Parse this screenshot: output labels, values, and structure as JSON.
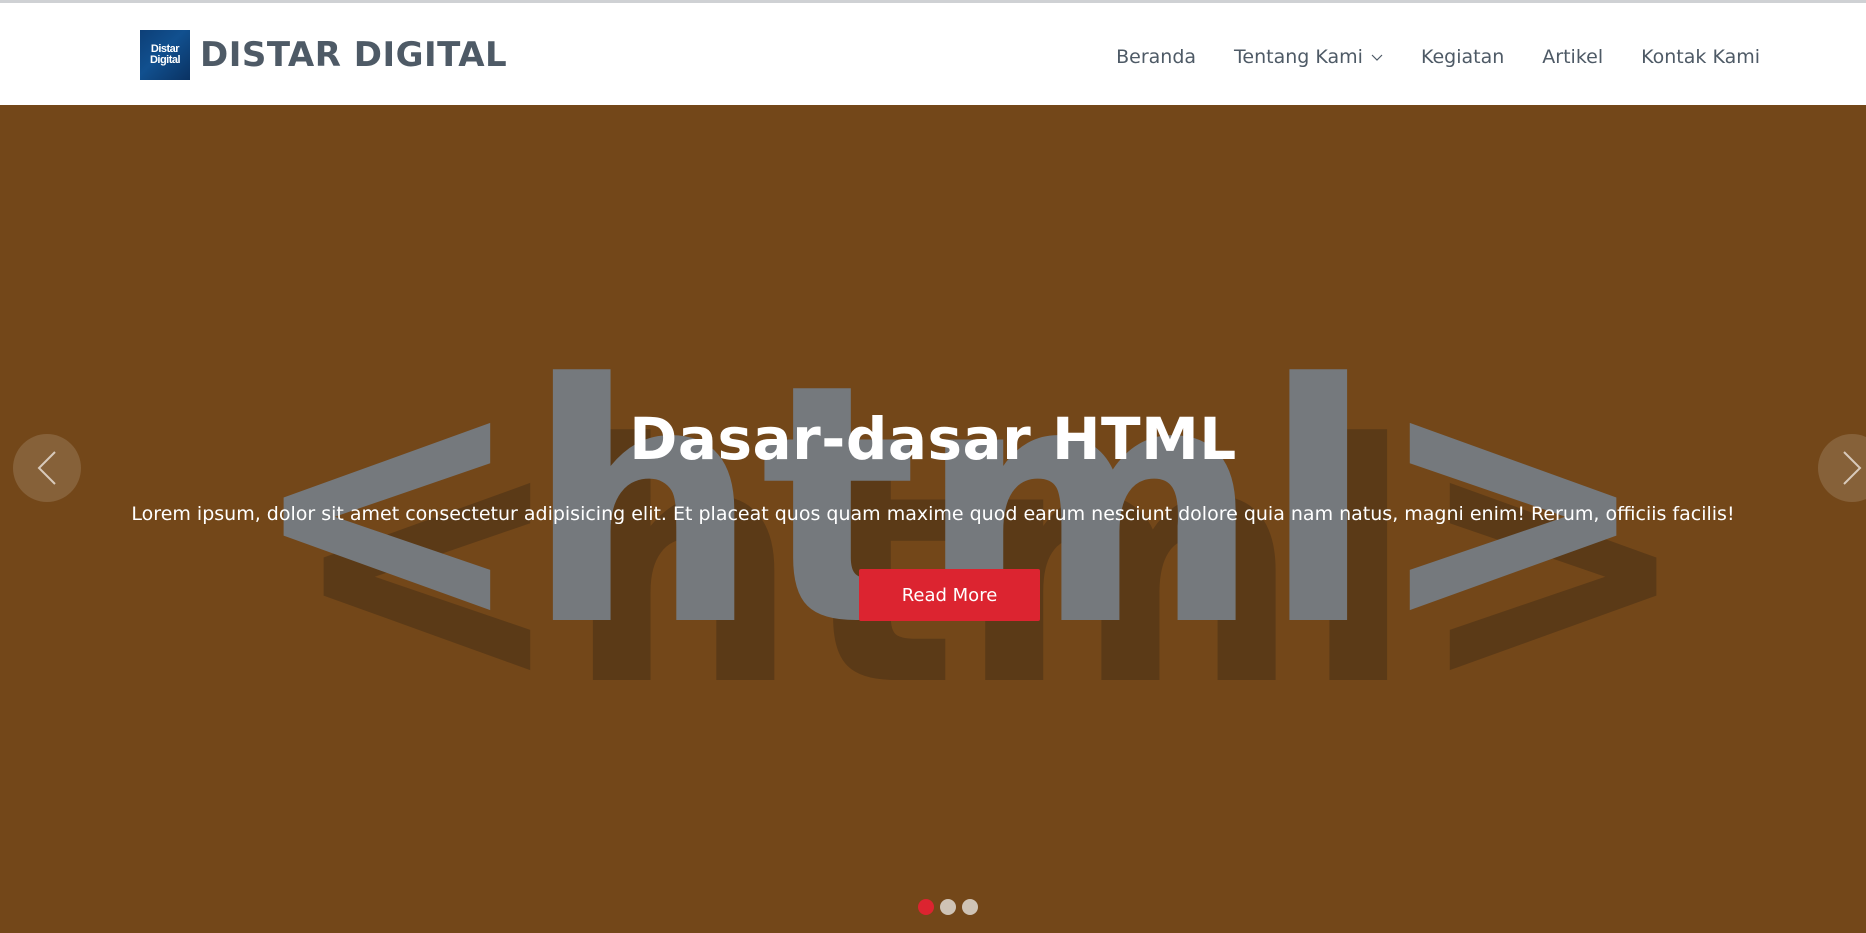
{
  "brand": {
    "logo_line1": "Distar",
    "logo_line2": "Digital",
    "name": "DISTAR DIGITAL"
  },
  "nav": {
    "items": [
      {
        "label": "Beranda"
      },
      {
        "label": "Tentang Kami",
        "has_dropdown": true
      },
      {
        "label": "Kegiatan"
      },
      {
        "label": "Artikel"
      },
      {
        "label": "Kontak Kami"
      }
    ]
  },
  "hero": {
    "background_graphic_text": "<html>",
    "title": "Dasar-dasar HTML",
    "description": "Lorem ipsum, dolor sit amet consectetur adipisicing elit. Et placeat quos quam maxime quod earum nesciunt dolore quia nam natus, magni enim! Rerum, officiis facilis!",
    "button_label": "Read More",
    "prev_icon": "chevron-left-icon",
    "next_icon": "chevron-right-icon",
    "slides_count": 3,
    "active_slide": 1
  },
  "colors": {
    "hero_bg": "#734719",
    "accent": "#dc2430",
    "nav_text": "#4e5a66"
  }
}
